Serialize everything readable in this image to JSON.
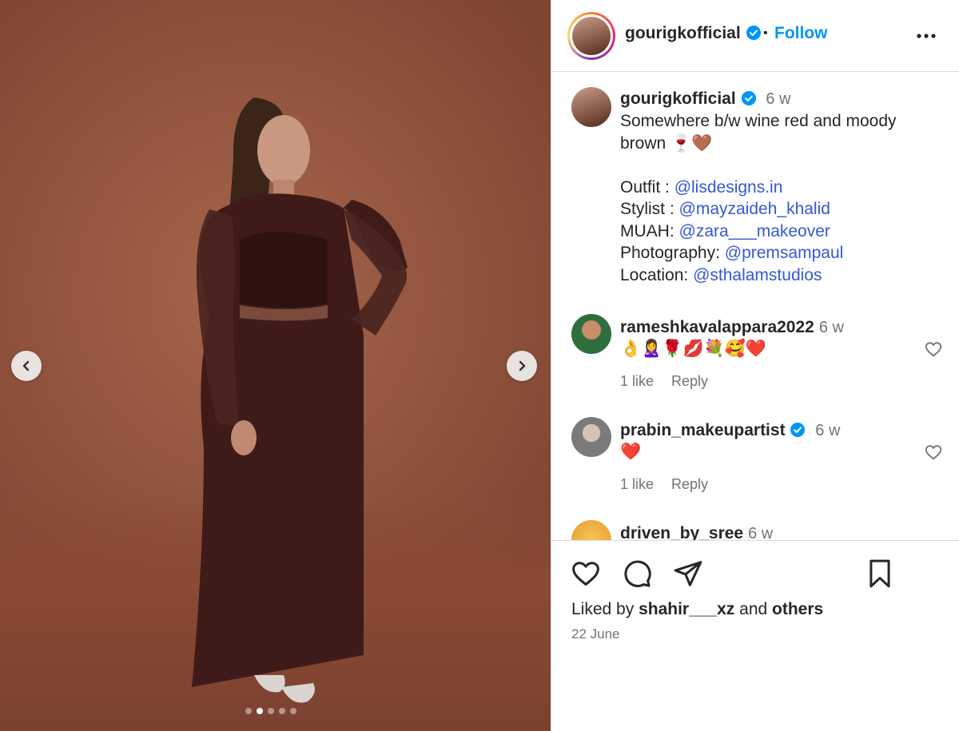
{
  "post": {
    "username": "gourigkofficial",
    "separator": "•",
    "follow_label": "Follow"
  },
  "caption": {
    "username": "gourigkofficial",
    "time": "6 w",
    "line1": "Somewhere b/w wine red and moody",
    "line2": "brown 🍷🤎",
    "credits": [
      {
        "label": "Outfit : ",
        "handle": "@lisdesigns.in"
      },
      {
        "label": "Stylist : ",
        "handle": "@mayzaideh_khalid"
      },
      {
        "label": "MUAH: ",
        "handle": "@zara___makeover"
      },
      {
        "label": "Photography: ",
        "handle": "@premsampaul"
      },
      {
        "label": "Location: ",
        "handle": "@sthalamstudios"
      }
    ]
  },
  "comments": [
    {
      "username": "rameshkavalappara2022",
      "time": "6 w",
      "text": "👌🙎‍♀️🌹💋💐🥰❤️",
      "likes": "1 like",
      "reply": "Reply"
    },
    {
      "username": "prabin_makeupartist",
      "time": "6 w",
      "text": "❤️",
      "likes": "1 like",
      "reply": "Reply"
    },
    {
      "username": "driven_by_sree",
      "time": "6 w"
    }
  ],
  "footer": {
    "liked_prefix": "Liked by ",
    "liked_user": "shahir___xz",
    "liked_mid": " and ",
    "liked_others": "others",
    "date": "22 June"
  },
  "carousel": {
    "dot_count": 5,
    "active_index": 1
  }
}
